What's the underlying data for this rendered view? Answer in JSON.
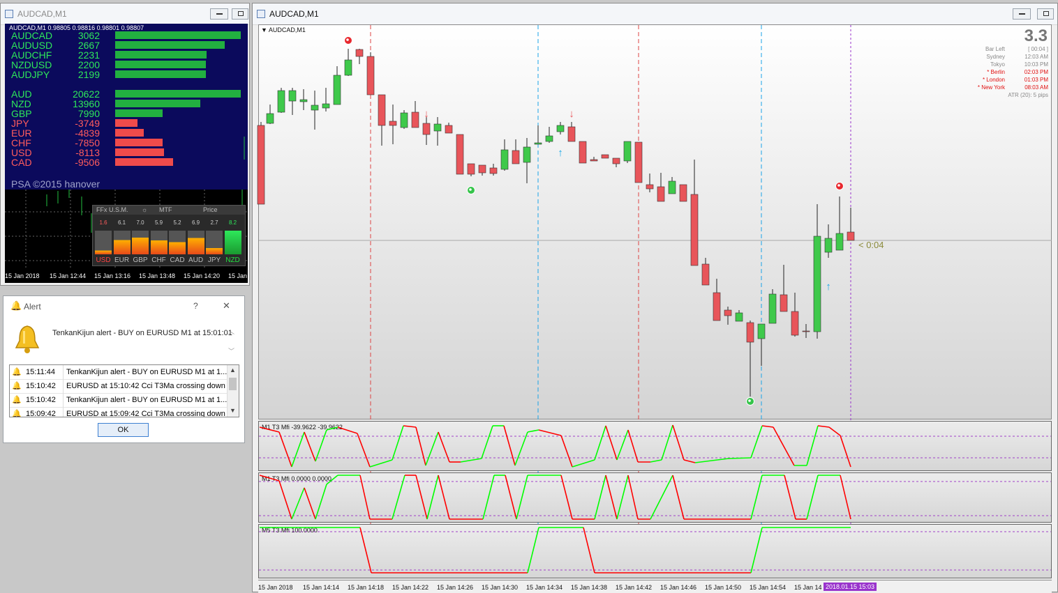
{
  "left_window": {
    "title": "AUDCAD,M1",
    "header": "AUDCAD,M1  0.98805 0.98816 0.98801 0.98807",
    "pairs": [
      {
        "name": "AUDCAD",
        "value": "3062",
        "level": 1.0
      },
      {
        "name": "AUDUSD",
        "value": "2667",
        "level": 0.87
      },
      {
        "name": "AUDCHF",
        "value": "2231",
        "level": 0.73
      },
      {
        "name": "NZDUSD",
        "value": "2200",
        "level": 0.72
      },
      {
        "name": "AUDJPY",
        "value": "2199",
        "level": 0.72
      }
    ],
    "currencies": [
      {
        "name": "AUD",
        "value": "20622",
        "level": 1.0,
        "sign": "pos"
      },
      {
        "name": "NZD",
        "value": "13960",
        "level": 0.68,
        "sign": "pos"
      },
      {
        "name": "GBP",
        "value": "7990",
        "level": 0.38,
        "sign": "pos"
      },
      {
        "name": "JPY",
        "value": "-3749",
        "level": 0.18,
        "sign": "neg"
      },
      {
        "name": "EUR",
        "value": "-4839",
        "level": 0.23,
        "sign": "neg"
      },
      {
        "name": "CHF",
        "value": "-7850",
        "level": 0.38,
        "sign": "neg"
      },
      {
        "name": "USD",
        "value": "-8113",
        "level": 0.39,
        "sign": "neg"
      },
      {
        "name": "CAD",
        "value": "-9506",
        "level": 0.46,
        "sign": "neg"
      }
    ],
    "copyright": "PSA ©2015 hanover",
    "mtf": {
      "headers": [
        "FFx U.S.M.",
        "MTF",
        "Price"
      ],
      "values": [
        "1.6",
        "6.1",
        "7.0",
        "5.9",
        "5.2",
        "6.9",
        "2.7",
        "8.2"
      ],
      "currencies": [
        "USD",
        "EUR",
        "GBP",
        "CHF",
        "CAD",
        "AUD",
        "JPY",
        "NZD"
      ]
    },
    "x_labels": [
      "15 Jan 2018",
      "15 Jan 12:44",
      "15 Jan 13:16",
      "15 Jan 13:48",
      "15 Jan 14:20",
      "15 Jan"
    ]
  },
  "alert": {
    "title": "Alert",
    "help": "?",
    "close": "✕",
    "message": "TenkanKijun alert - BUY on EURUSD M1 at 15:01:01",
    "rows": [
      {
        "time": "15:11:44",
        "text": "TenkanKijun alert - BUY on EURUSD M1 at 1..."
      },
      {
        "time": "15:10:42",
        "text": "EURUSD at 15:10:42 Cci T3Ma crossing down"
      },
      {
        "time": "15:10:42",
        "text": "TenkanKijun alert - BUY on EURUSD M1 at 1..."
      },
      {
        "time": "15:09:42",
        "text": "EURUSD at 15:09:42 Cci T3Ma crossing down"
      }
    ],
    "ok": "OK"
  },
  "main_window": {
    "title": "AUDCAD,M1",
    "chart_label": "AUDCAD,M1",
    "spread": "3.3",
    "sessions": [
      {
        "name": "Bar Left",
        "value": "[ 00:04 ]",
        "active": false
      },
      {
        "name": "Sydney",
        "value": "12:03 AM",
        "active": false
      },
      {
        "name": "Tokyo",
        "value": "10:03 PM",
        "active": false
      },
      {
        "name": "* Berlin",
        "value": "02:03 PM",
        "active": true
      },
      {
        "name": "* London",
        "value": "01:03 PM",
        "active": true
      },
      {
        "name": "* New York",
        "value": "08:03 AM",
        "active": true
      }
    ],
    "atr": "ATR (20): 5 pips",
    "countdown": "< 0:04",
    "osc_labels": [
      "M1  T3 Mfi  -39.9622 -39.9622",
      "M1  T3 Mfi  0.0000 0.0000",
      "M5  T3 Mfi  100.0000"
    ],
    "x_labels": [
      "15 Jan 2018",
      "15 Jan 14:14",
      "15 Jan 14:18",
      "15 Jan 14:22",
      "15 Jan 14:26",
      "15 Jan 14:30",
      "15 Jan 14:34",
      "15 Jan 14:38",
      "15 Jan 14:42",
      "15 Jan 14:46",
      "15 Jan 14:50",
      "15 Jan 14:54",
      "15 Jan 14"
    ],
    "current_time": "2018.01.15 15:03",
    "colors": {
      "bull": "#3fc94b",
      "bear": "#e8555a",
      "osc_up": "#00ff00",
      "osc_down": "#ff0000",
      "cursor": "#9933cc"
    }
  }
}
